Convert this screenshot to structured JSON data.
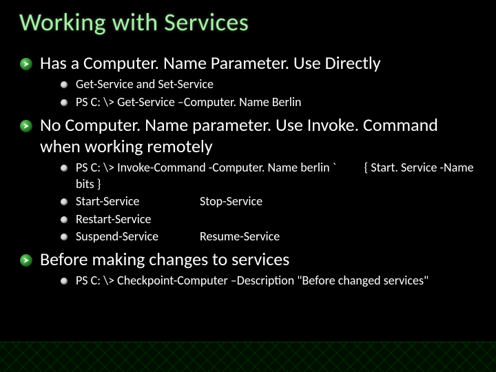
{
  "title": "Working with Services",
  "sections": [
    {
      "heading": "Has a Computer. Name Parameter. Use Directly",
      "items": [
        "Get-Service  and Set-Service",
        "PS C: \\> Get-Service –Computer. Name Berlin"
      ]
    },
    {
      "heading": "No Computer. Name parameter. Use Invoke. Command when working remotely",
      "items_rich": [
        {
          "left": "PS C: \\> Invoke-Command -Computer. Name berlin  `",
          "right": "{ Start. Service -Name bits }"
        },
        {
          "col1": "Start-Service",
          "col2": "Stop-Service"
        },
        {
          "col1": "Restart-Service",
          "col2": ""
        },
        {
          "col1": "Suspend-Service",
          "col2": "Resume-Service"
        }
      ]
    },
    {
      "heading": "Before making changes to services",
      "items": [
        "PS C: \\> Checkpoint-Computer –Description \"Before changed services\""
      ]
    }
  ]
}
